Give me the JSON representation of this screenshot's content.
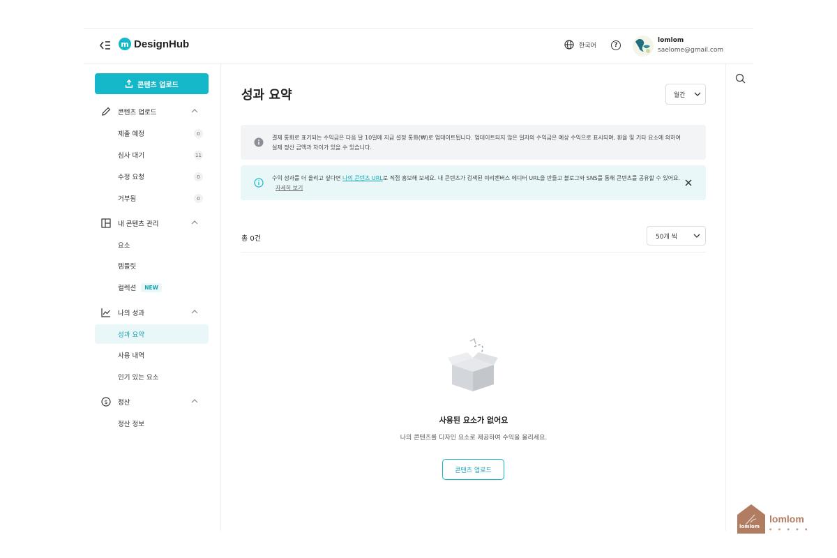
{
  "header": {
    "logo_mark": "m",
    "logo_text": "DesignHub",
    "language": "한국어",
    "help": "?",
    "user_name": "lomlom",
    "user_email": "saelome@gmail.com"
  },
  "sidebar": {
    "upload_button": "콘텐츠 업로드",
    "sections": [
      {
        "label": "콘텐츠 업로드",
        "icon": "pencil-icon",
        "items": [
          {
            "label": "제출 예정",
            "count": "0"
          },
          {
            "label": "심사 대기",
            "count": "11"
          },
          {
            "label": "수정 요청",
            "count": "0"
          },
          {
            "label": "거부됨",
            "count": "0"
          }
        ]
      },
      {
        "label": "내 콘텐츠 관리",
        "icon": "layout-icon",
        "items": [
          {
            "label": "요소"
          },
          {
            "label": "템플릿"
          },
          {
            "label": "컬렉션",
            "badge": "NEW"
          }
        ]
      },
      {
        "label": "나의 성과",
        "icon": "chart-line-icon",
        "items": [
          {
            "label": "성과 요약",
            "active": true
          },
          {
            "label": "사용 내역"
          },
          {
            "label": "인기 있는 요소"
          }
        ]
      },
      {
        "label": "정산",
        "icon": "dollar-circle-icon",
        "items": [
          {
            "label": "정산 정보"
          }
        ]
      }
    ]
  },
  "main": {
    "title": "성과 요약",
    "period_select": "월간",
    "notice_grey": "결제 통화로 표기되는 수익금은 다음 달 10일에 지급 설정 통화(₩)로 업데이트됩니다. 업데이트되지 않은 일자의 수익금은 예상 수익으로 표시되며, 환율 및 기타 요소에 의하여 실제 정산 금액과 차이가 있을 수 있습니다.",
    "notice_cyan": {
      "before": "수익 성과를 더 올리고 싶다면 ",
      "link": "나의 콘텐츠 URL",
      "after": "로 직접 홍보해 보세요. 내 콘텐츠가 검색된 미리캔버스 에디터 URL을 만들고 블로그와 SNS를 통해 콘텐츠를 공유할 수 있어요.",
      "more": "자세히 보기"
    },
    "total": "총 0건",
    "per_page_select": "50개 씩",
    "empty_title": "사용된 요소가 없어요",
    "empty_subtitle": "나의 콘텐츠를 디자인 요소로 제공하여 수익을 올리세요.",
    "empty_button": "콘텐츠 업로드"
  },
  "watermark": {
    "text": "lomlom",
    "house_label": "lomlom"
  },
  "colors": {
    "accent": "#15b8c9",
    "accent_light": "#eaf7f9",
    "notice_grey": "#f3f4f5"
  }
}
